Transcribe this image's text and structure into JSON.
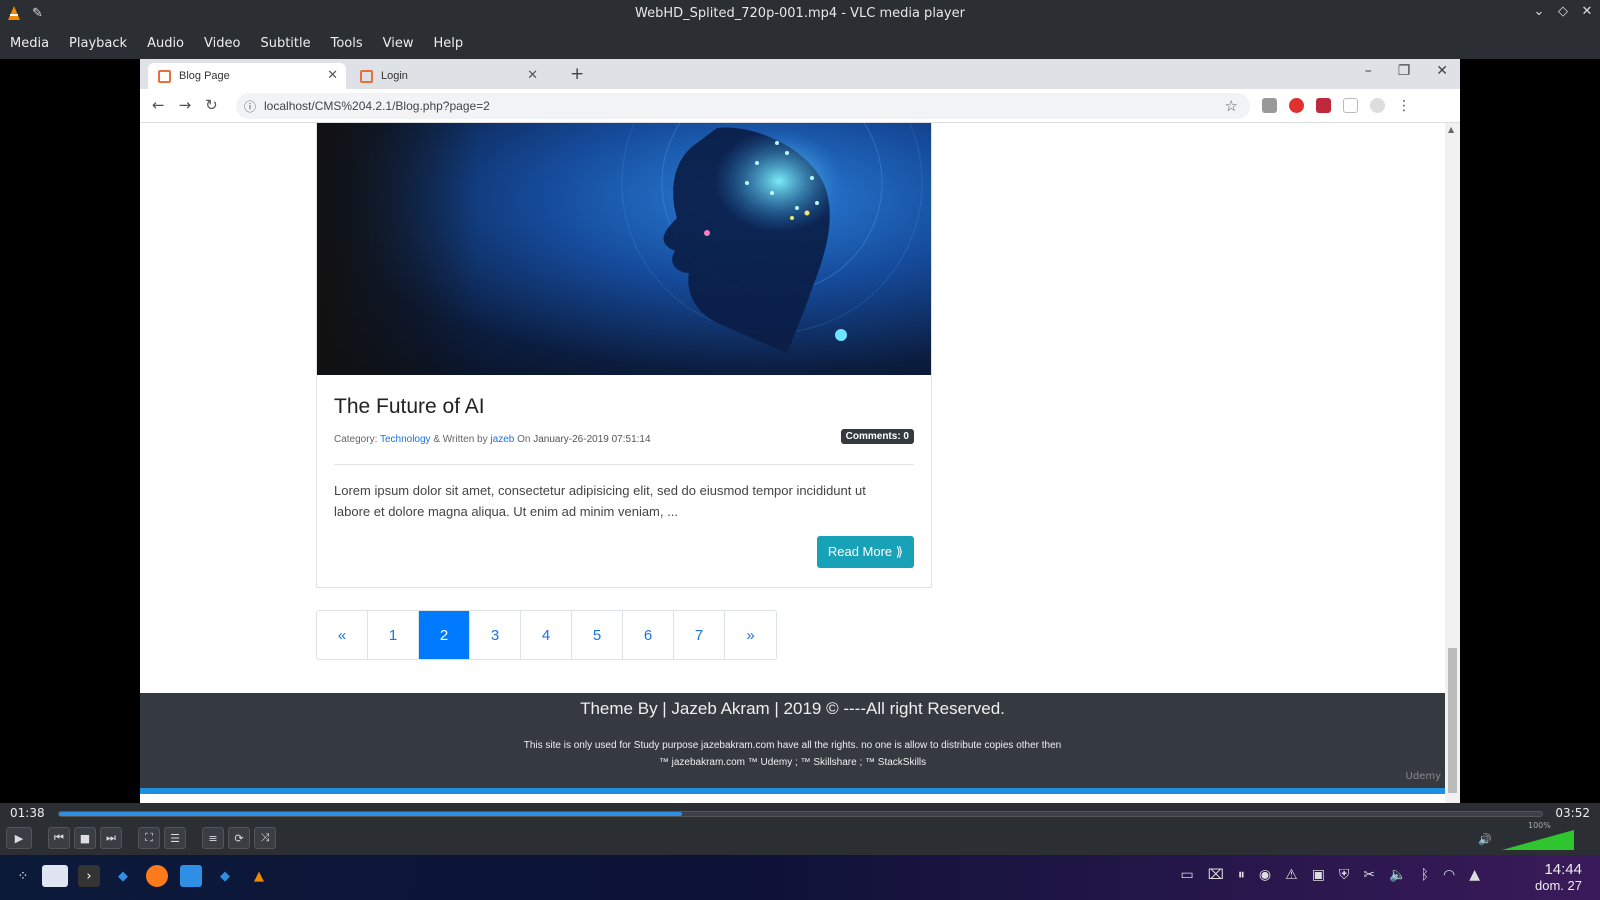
{
  "window": {
    "title": "WebHD_Splited_720p-001.mp4 - VLC media player"
  },
  "menu": {
    "items": [
      "Media",
      "Playback",
      "Audio",
      "Video",
      "Subtitle",
      "Tools",
      "View",
      "Help"
    ]
  },
  "browser": {
    "tabs": [
      {
        "label": "Blog Page",
        "active": true
      },
      {
        "label": "Login",
        "active": false
      }
    ],
    "url": "localhost/CMS%204.2.1/Blog.php?page=2"
  },
  "post": {
    "title": "The Future of AI",
    "meta_category_prefix": "Category:",
    "category": "Technology",
    "meta_written_by": "& Written by",
    "author": "jazeb",
    "meta_on": "On",
    "date": "January-26-2019 07:51:14",
    "comments_badge": "Comments: 0",
    "excerpt": "Lorem ipsum dolor sit amet, consectetur adipisicing elit, sed do eiusmod tempor incididunt ut labore et dolore magna aliqua. Ut enim ad minim veniam, ...",
    "read_more": "Read More ⟫"
  },
  "pagination": {
    "items": [
      "«",
      "1",
      "2",
      "3",
      "4",
      "5",
      "6",
      "7",
      "»"
    ],
    "active": "2"
  },
  "footer": {
    "main": "Theme By | Jazeb Akram | 2019 © ----All right Reserved.",
    "note_line1": "This site is only used for Study purpose jazebakram.com have all the rights. no one is allow to distribute copies other then",
    "note_line2": "™ jazebakram.com ™ Udemy ; ™ Skillshare ; ™ StackSkills",
    "watermark": "Udemy"
  },
  "player": {
    "elapsed": "01:38",
    "total": "03:52",
    "progress": 0.42,
    "volume_label": "100%",
    "volume_level": 1.0
  },
  "taskbar": {
    "time": "14:44",
    "date": "dom. 27"
  },
  "colors": {
    "accent": "#2e8fe4",
    "read_more": "#17a2b8",
    "active_page": "#007bff",
    "footer_bg": "#353a41"
  }
}
